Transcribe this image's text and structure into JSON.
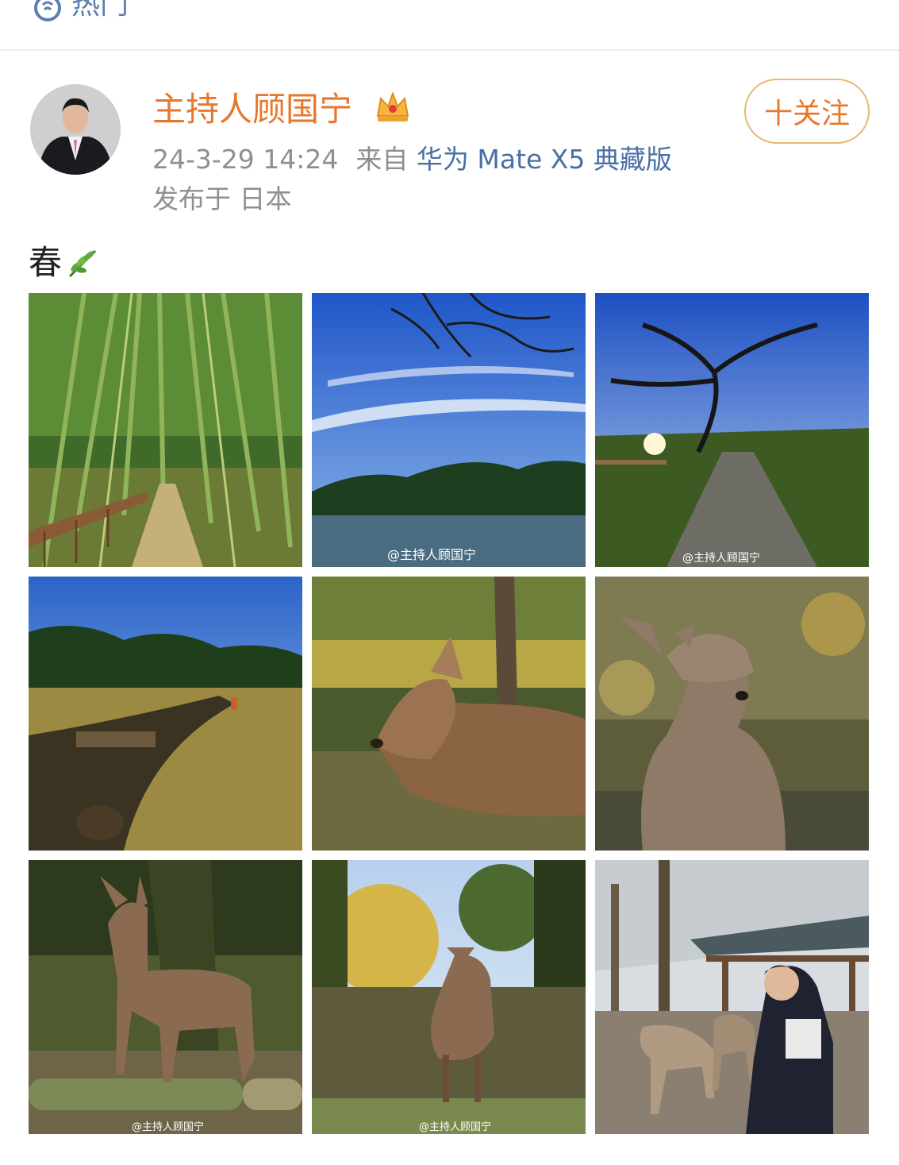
{
  "top_tab": {
    "label": "热门"
  },
  "post": {
    "author": "主持人顾国宁",
    "timestamp": "24-3-29 14:24",
    "source_prefix": "来自",
    "device": "华为 Mate X5 典藏版",
    "location": "发布于 日本",
    "follow_label": "十关注",
    "text": "春"
  },
  "photos": [
    {
      "subject": "bamboo forest path",
      "watermark": ""
    },
    {
      "subject": "lake under blue sky with bare branches",
      "watermark": "@主持人顾国宁"
    },
    {
      "subject": "park path with bare tree and sun",
      "watermark": "@主持人顾国宁"
    },
    {
      "subject": "grassy park with stream",
      "watermark": ""
    },
    {
      "subject": "deer resting near a pole",
      "watermark": ""
    },
    {
      "subject": "deer sitting in sunlight",
      "watermark": ""
    },
    {
      "subject": "deer standing on roots",
      "watermark": "@主持人顾国宁"
    },
    {
      "subject": "deer eating leaves under tree",
      "watermark": "@主持人顾国宁"
    },
    {
      "subject": "man feeding deer near pavilion",
      "watermark": ""
    }
  ],
  "colors": {
    "author": "#e9772b",
    "link": "#4a6fa5",
    "meta": "#8f8f8f",
    "follow_border": "#e8b86f"
  }
}
